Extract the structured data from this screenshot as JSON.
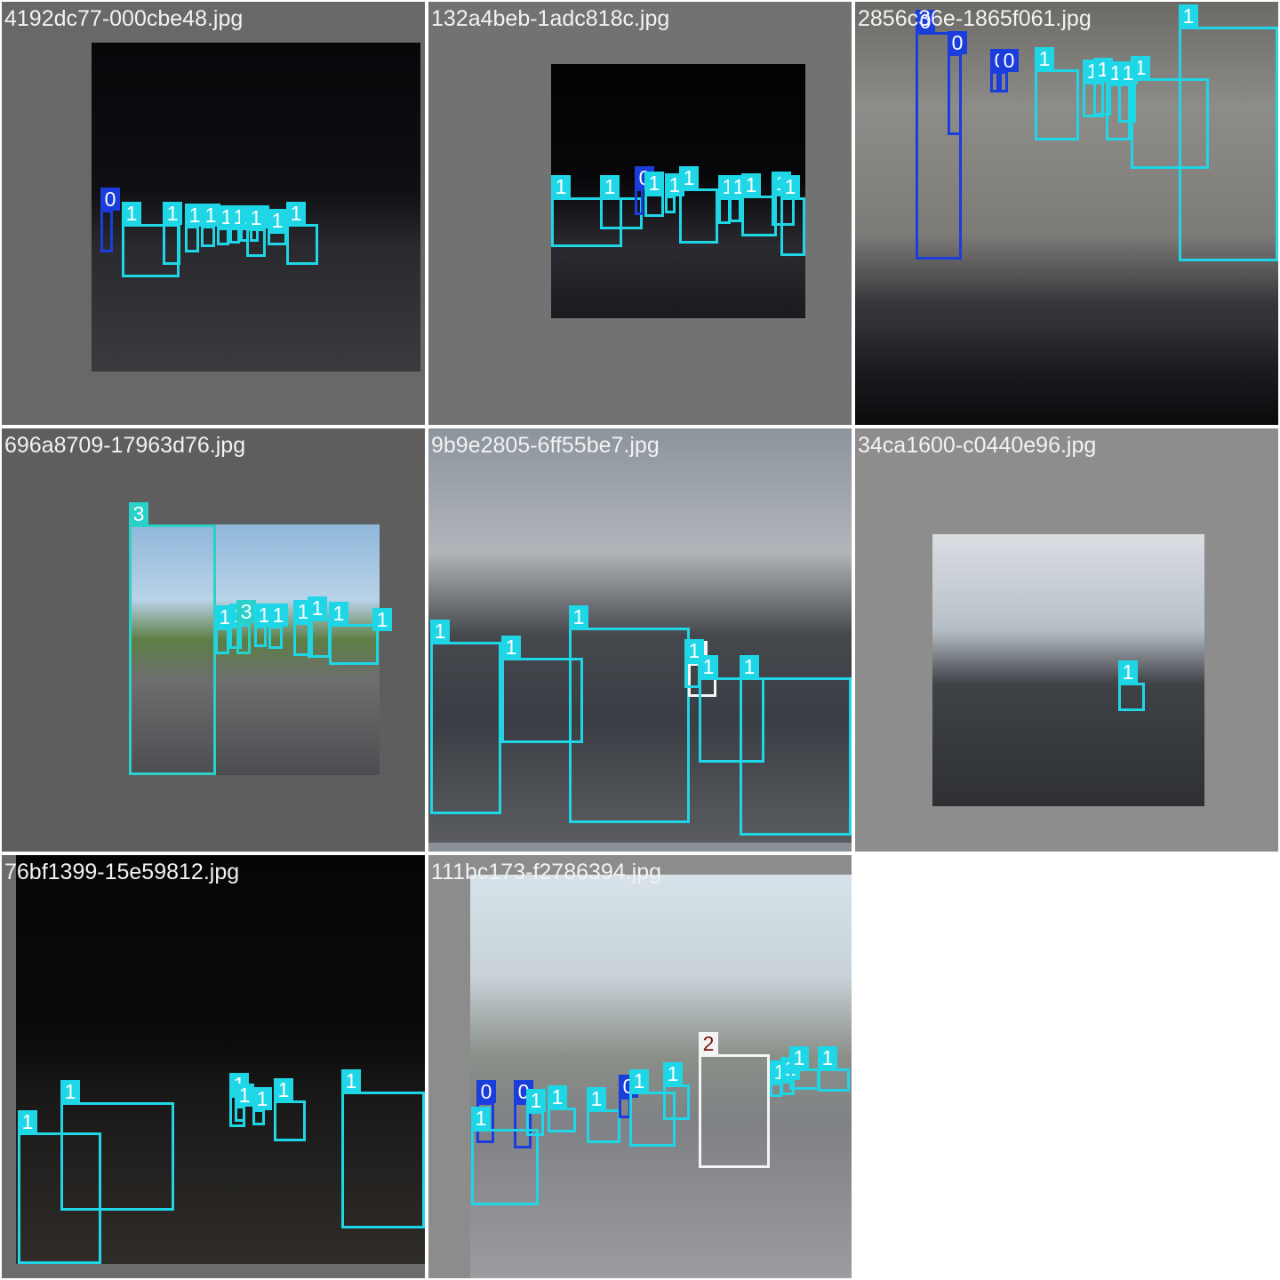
{
  "class_colors": {
    "0": "#1a3ddb",
    "1": "#1fd6e6",
    "2": "#f4f4f4",
    "3": "#2ad1c8"
  },
  "tiles": [
    {
      "name": "4192dc77-000cbe48.jpg",
      "boxes": [
        {
          "label": "0"
        },
        {
          "label": "1"
        },
        {
          "label": "1"
        },
        {
          "label": "1"
        },
        {
          "label": "1"
        },
        {
          "label": "1"
        },
        {
          "label": "1"
        },
        {
          "label": "1"
        },
        {
          "label": "1"
        },
        {
          "label": "1"
        },
        {
          "label": "1"
        },
        {
          "label": "1"
        }
      ]
    },
    {
      "name": "132a4beb-1adc818c.jpg",
      "boxes": [
        {
          "label": "1"
        },
        {
          "label": "1"
        },
        {
          "label": "0"
        },
        {
          "label": "1"
        },
        {
          "label": "1"
        },
        {
          "label": "1"
        },
        {
          "label": "1"
        },
        {
          "label": "1"
        },
        {
          "label": "1"
        },
        {
          "label": "1"
        },
        {
          "label": "1"
        }
      ]
    },
    {
      "name": "2856c36e-1865f061.jpg",
      "boxes": [
        {
          "label": "0"
        },
        {
          "label": "0"
        },
        {
          "label": "0"
        },
        {
          "label": "0"
        },
        {
          "label": "1"
        },
        {
          "label": "1"
        },
        {
          "label": "1"
        },
        {
          "label": "1"
        },
        {
          "label": "1"
        },
        {
          "label": "1"
        },
        {
          "label": "1"
        }
      ]
    },
    {
      "name": "696a8709-17963d76.jpg",
      "boxes": [
        {
          "label": "3"
        },
        {
          "label": "1"
        },
        {
          "label": "1"
        },
        {
          "label": "3"
        },
        {
          "label": "1"
        },
        {
          "label": "1"
        },
        {
          "label": "1"
        },
        {
          "label": "1"
        },
        {
          "label": "1"
        },
        {
          "label": "1"
        }
      ]
    },
    {
      "name": "9b9e2805-6ff55be7.jpg",
      "boxes": [
        {
          "label": "1"
        },
        {
          "label": "1"
        },
        {
          "label": "1"
        },
        {
          "label": "2"
        },
        {
          "label": "1"
        },
        {
          "label": "1"
        },
        {
          "label": "1"
        }
      ]
    },
    {
      "name": "34ca1600-c0440e96.jpg",
      "boxes": [
        {
          "label": "1"
        }
      ]
    },
    {
      "name": "76bf1399-15e59812.jpg",
      "boxes": [
        {
          "label": "1"
        },
        {
          "label": "1"
        },
        {
          "label": "1"
        },
        {
          "label": "1"
        },
        {
          "label": "1"
        },
        {
          "label": "1"
        },
        {
          "label": "1"
        }
      ]
    },
    {
      "name": "111bc173-f2786394.jpg",
      "boxes": [
        {
          "label": "0"
        },
        {
          "label": "0"
        },
        {
          "label": "1"
        },
        {
          "label": "1"
        },
        {
          "label": "1"
        },
        {
          "label": "1"
        },
        {
          "label": "0"
        },
        {
          "label": "1"
        },
        {
          "label": "1"
        },
        {
          "label": "2"
        },
        {
          "label": "1"
        },
        {
          "label": "1"
        },
        {
          "label": "1"
        },
        {
          "label": "1"
        }
      ]
    }
  ]
}
